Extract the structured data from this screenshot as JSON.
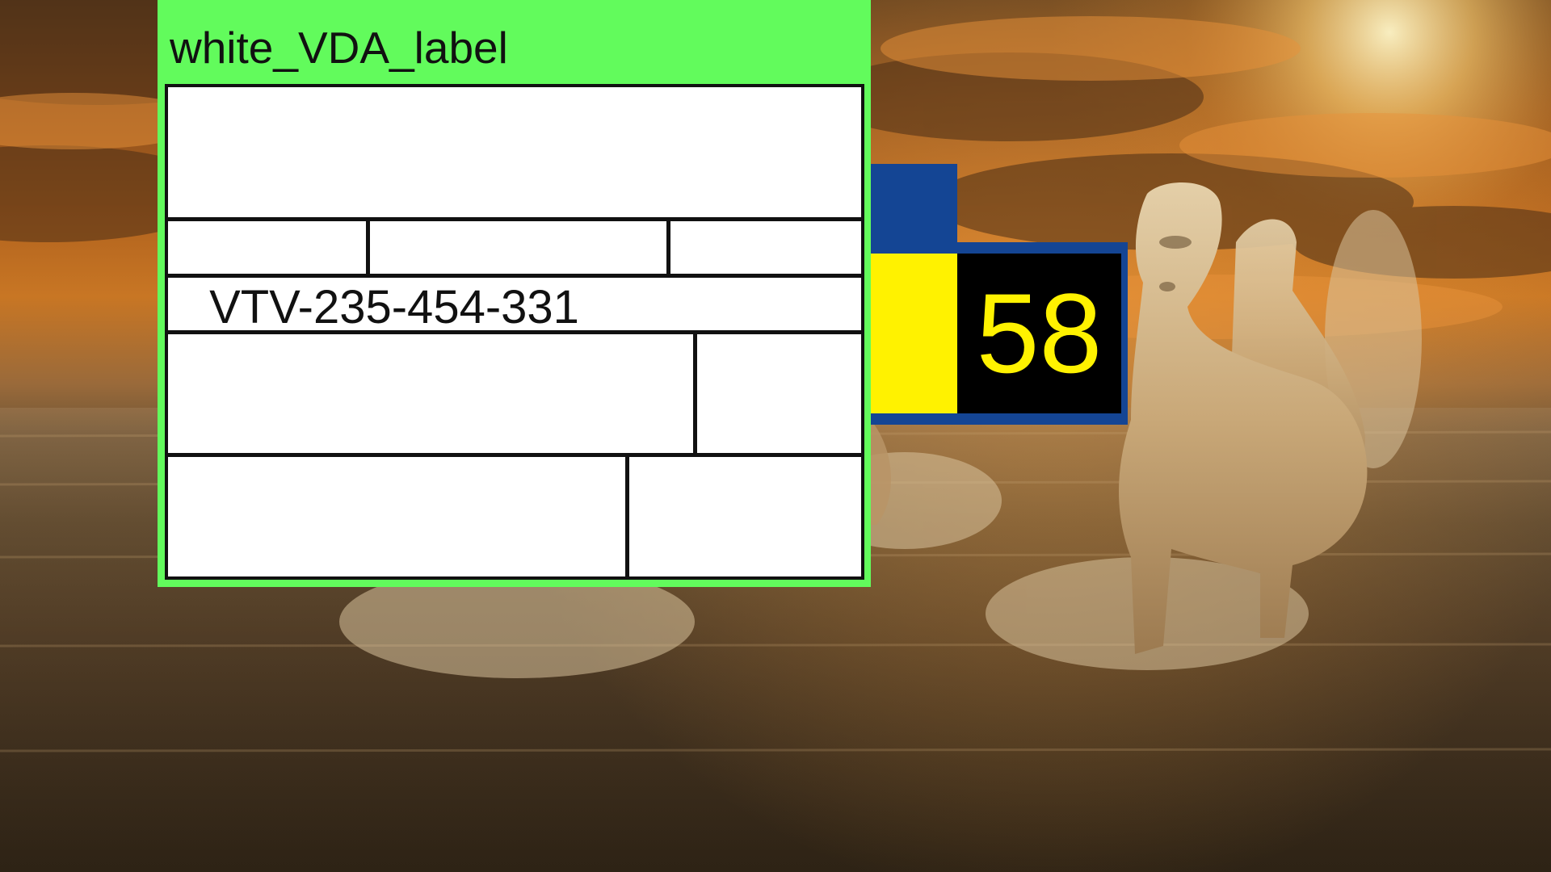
{
  "label_window": {
    "title": "white_VDA_label",
    "background_color": "#62fb5c",
    "sheet": {
      "background_color": "#ffffff",
      "identifier": "VTV-235-454-331"
    }
  },
  "counter": {
    "value": "58",
    "frame_color": "#144594",
    "indicator_color": "#fff200",
    "value_color": "#fff200",
    "value_background": "#000000"
  },
  "background": {
    "scene": "horses-running-through-water-at-sunset"
  }
}
